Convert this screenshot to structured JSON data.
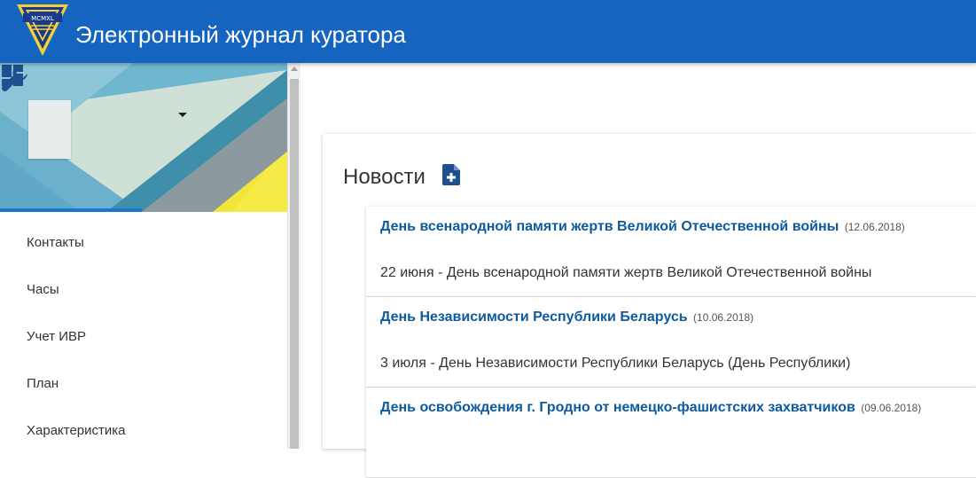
{
  "app": {
    "title": "Электронный журнал куратора",
    "logo_text": "MCMXL",
    "brand_color": "#1565c0"
  },
  "sidebar": {
    "tabs": [
      {
        "icon": "dashboard-icon",
        "active": true
      },
      {
        "icon": "wrench-icon",
        "active": false
      }
    ],
    "items": [
      {
        "label": "Контакты"
      },
      {
        "label": "Часы"
      },
      {
        "label": "Учет ИВР"
      },
      {
        "label": "План"
      },
      {
        "label": "Характеристика"
      }
    ]
  },
  "news": {
    "title": "Новости",
    "add_icon": "file-plus-icon",
    "items": [
      {
        "title": "День всенародной памяти жертв Великой Отечественной войны",
        "date": "(12.06.2018)",
        "body": "22 июня - День всенародной памяти жертв Великой Отечественной войны"
      },
      {
        "title": "День Независимости Республики Беларусь",
        "date": "(10.06.2018)",
        "body": "3 июля - День Независимости Республики Беларусь (День Республики)"
      },
      {
        "title": "День освобождения г. Гродно от немецко-фашистских захватчиков",
        "date": "(09.06.2018)",
        "body": ""
      }
    ]
  }
}
